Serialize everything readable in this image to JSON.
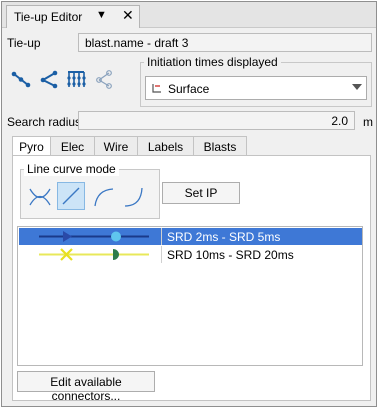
{
  "window": {
    "tab_title": "Tie-up Editor",
    "menu_icon": "dropdown-arrow-icon",
    "close_icon": "close-x-icon"
  },
  "tieup": {
    "label": "Tie-up",
    "value": "blast.name - draft 3"
  },
  "toolbar": {
    "icons": [
      "connect-line-icon",
      "fan-connect-icon",
      "grid-connect-icon",
      "share-connect-icon"
    ]
  },
  "initiation": {
    "title": "Initiation times displayed",
    "selected": "Surface",
    "icon": "surface-layer-icon"
  },
  "search_radius": {
    "label": "Search radius",
    "value": "2.0",
    "unit": "m"
  },
  "tabs": [
    {
      "label": "Pyro",
      "active": true
    },
    {
      "label": "Elec",
      "active": false
    },
    {
      "label": "Wire",
      "active": false
    },
    {
      "label": "Labels",
      "active": false
    },
    {
      "label": "Blasts",
      "active": false
    }
  ],
  "line_curve_mode": {
    "title": "Line curve mode",
    "modes": [
      "cross-curve-icon",
      "straight-line-icon",
      "arc-curve-icon",
      "s-curve-icon"
    ],
    "active_mode": "straight-line-icon"
  },
  "set_ip_label": "Set IP",
  "connectors": [
    {
      "label": "SRD 2ms - SRD 5ms",
      "selected": true,
      "line_color": "#1a3a8a",
      "marker_color": "#2a4aa8",
      "end_color": "#5fc6ee"
    },
    {
      "label": "SRD 10ms - SRD 20ms",
      "selected": false,
      "line_color": "#e8e85a",
      "marker_color": "#e8e020",
      "end_color": "#2e7d4a"
    }
  ],
  "edit_connectors_label": "Edit available connectors..."
}
